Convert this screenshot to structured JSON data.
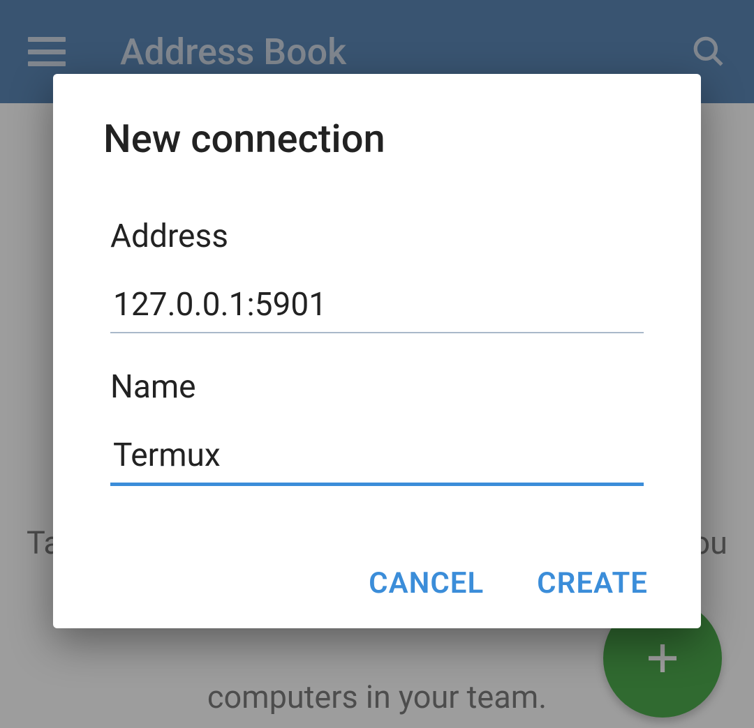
{
  "header": {
    "title": "Address Book"
  },
  "main": {
    "hint_line1": "Ta",
    "hint_line1_end": "ou",
    "hint_line2": "computers in your team."
  },
  "dialog": {
    "title": "New connection",
    "address_label": "Address",
    "address_value": "127.0.0.1:5901",
    "name_label": "Name",
    "name_value": "Termux",
    "cancel_label": "CANCEL",
    "create_label": "CREATE"
  }
}
